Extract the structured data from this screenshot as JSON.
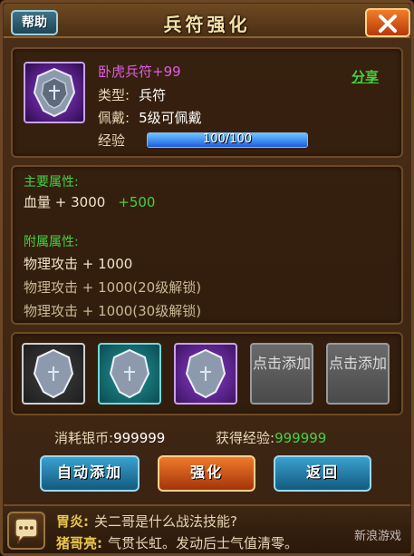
{
  "window": {
    "title": "兵符强化",
    "help_label": "帮助",
    "close_icon": "close-x-icon"
  },
  "item": {
    "name": "卧虎兵符+99",
    "type_label": "类型:",
    "type_value": "兵符",
    "equip_label": "佩戴:",
    "equip_value": "5级可佩戴",
    "exp_label": "经验",
    "exp_text": "100/100",
    "exp_progress": 1.0,
    "share_label": "分享",
    "icon": "tiger-tally-icon"
  },
  "attributes": {
    "main_title": "主要属性:",
    "main": [
      {
        "text": "血量 + 3000",
        "bonus": "+500"
      }
    ],
    "sub_title": "附属属性:",
    "sub": [
      {
        "text": "物理攻击 + 1000",
        "locked": false
      },
      {
        "text": "物理攻击 + 1000(20级解锁)",
        "locked": true
      },
      {
        "text": "物理攻击 + 1000(30级解锁)",
        "locked": true
      }
    ]
  },
  "slots": [
    {
      "kind": "item",
      "quality": "silver",
      "icon": "tally-icon"
    },
    {
      "kind": "item",
      "quality": "teal",
      "icon": "tally-icon"
    },
    {
      "kind": "item",
      "quality": "purple",
      "icon": "tally-icon"
    },
    {
      "kind": "empty",
      "label": "点击添加"
    },
    {
      "kind": "empty",
      "label": "点击添加"
    }
  ],
  "costs": {
    "silver_label": "消耗银币:",
    "silver_value": "999999",
    "exp_label": "获得经验:",
    "exp_value": "999999"
  },
  "buttons": {
    "auto_add": "自动添加",
    "strengthen": "强化",
    "back": "返回"
  },
  "chat": {
    "icon": "chat-bubble-icon",
    "messages": [
      {
        "speaker": "胃炎:",
        "text": "关二哥是什么战法技能?"
      },
      {
        "speaker": "猪哥亮:",
        "text": "气贯长虹。发动后士气值清零。"
      }
    ],
    "watermark": "新浪游戏"
  },
  "colors": {
    "frame_brown": "#4a2e17",
    "green_accent": "#44d044",
    "purple_name": "#e25ce2",
    "exp_blue": "#1d5ee0"
  }
}
